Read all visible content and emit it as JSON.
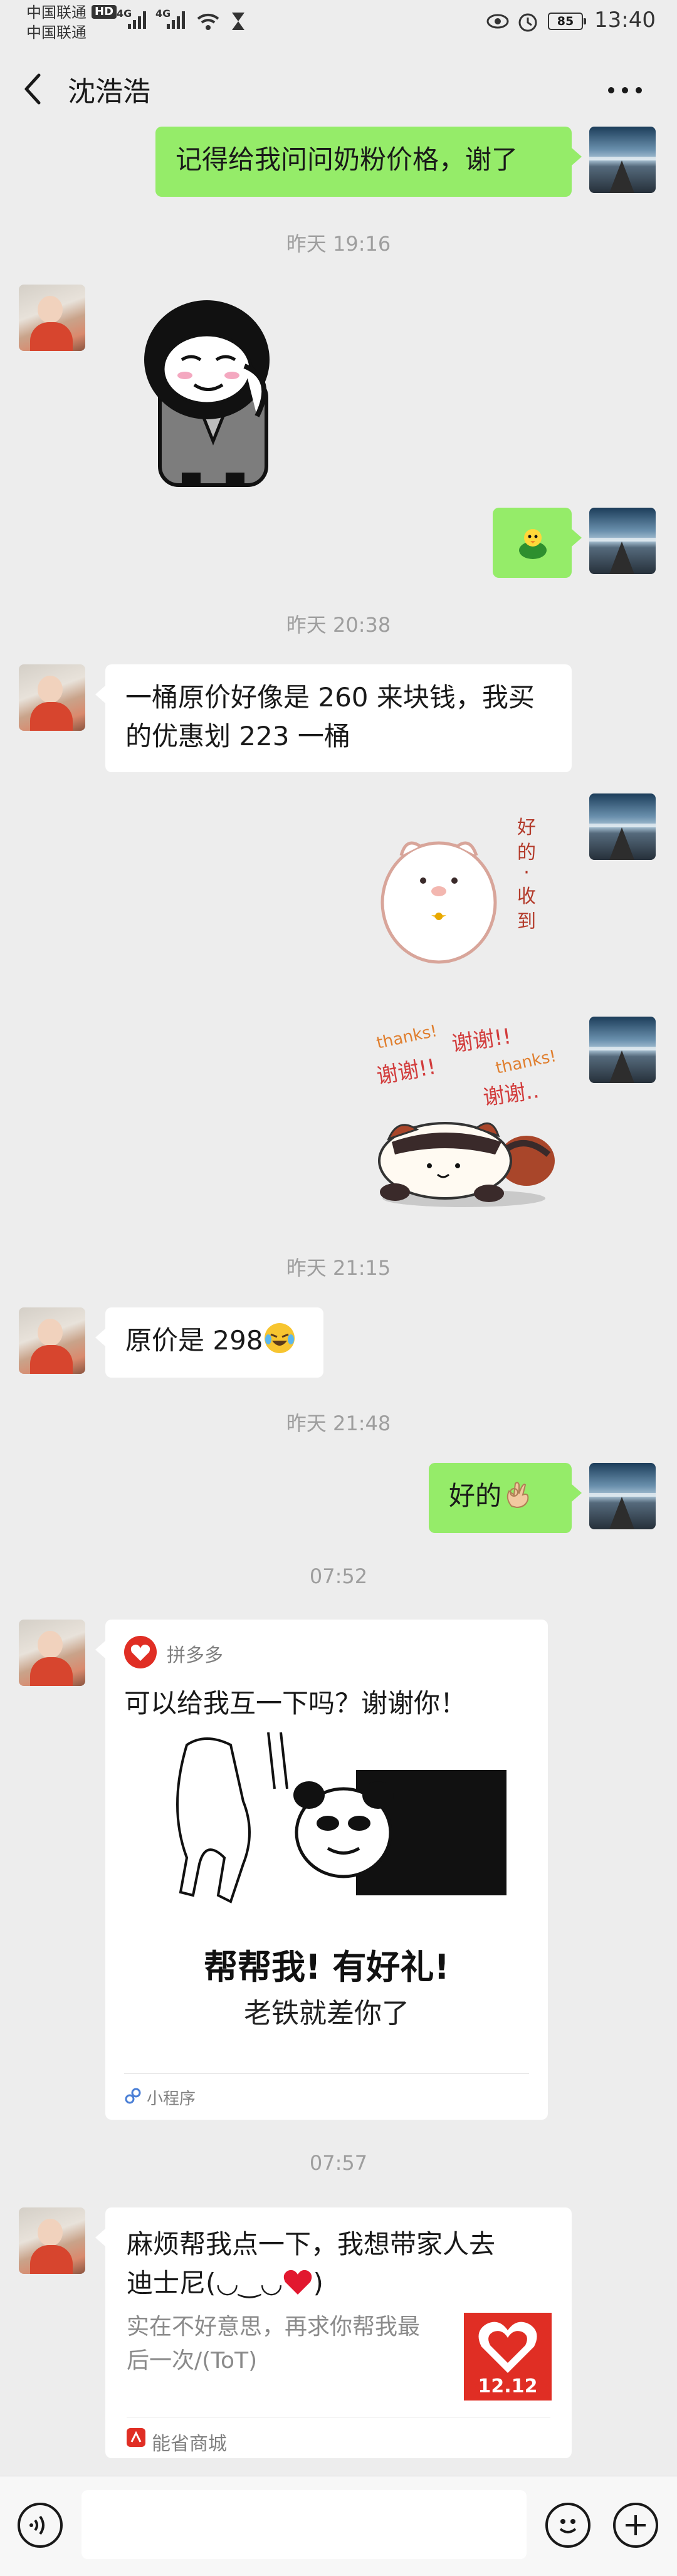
{
  "status_bar": {
    "carrier1": "中国联通",
    "carrier2": "中国联通",
    "hd": "HD",
    "net1": "4G",
    "net2": "4G",
    "battery": "85",
    "time": "13:40"
  },
  "header": {
    "title": "沈浩浩"
  },
  "messages": {
    "m1": "记得给我问问奶粉价格，谢了",
    "ts1": "昨天 19:16",
    "ts2": "昨天 20:38",
    "m2_line1": "一桶原价好像是 260 来块钱，我买",
    "m2_line2": "的优惠划 223 一桶",
    "sticker_text_vertical": "好的·收到",
    "ts3": "昨天 21:15",
    "m3": "原价是 298",
    "ts4": "昨天 21:48",
    "m4": "好的",
    "ts5": "07:52",
    "ts6": "07:57"
  },
  "mini_program_card": {
    "app_name": "拼多多",
    "title": "可以给我互一下吗？谢谢你！",
    "headline": "帮帮我! 有好礼!",
    "subline": "老铁就差你了",
    "footer": "小程序"
  },
  "link_card": {
    "title_line1": "麻烦帮我点一下，我想带家人去",
    "title_line2": "迪士尼(◡‿◡",
    "title_line2_end": ")",
    "desc_line1": "实在不好意思，再求你帮我最",
    "desc_line2": "后一次/(ToT)",
    "thumb_text": "12.12",
    "source": "能省商城"
  },
  "stickers": {
    "thanks_a": "thanks!",
    "thanks_b": "thanks!",
    "xie_a": "谢谢!!",
    "xie_b": "谢谢!!",
    "xie_c": "谢谢.."
  },
  "colors": {
    "self_bubble": "#95ec69",
    "other_bubble": "#ffffff",
    "background": "#ededed",
    "pdd_red": "#e02e24"
  }
}
